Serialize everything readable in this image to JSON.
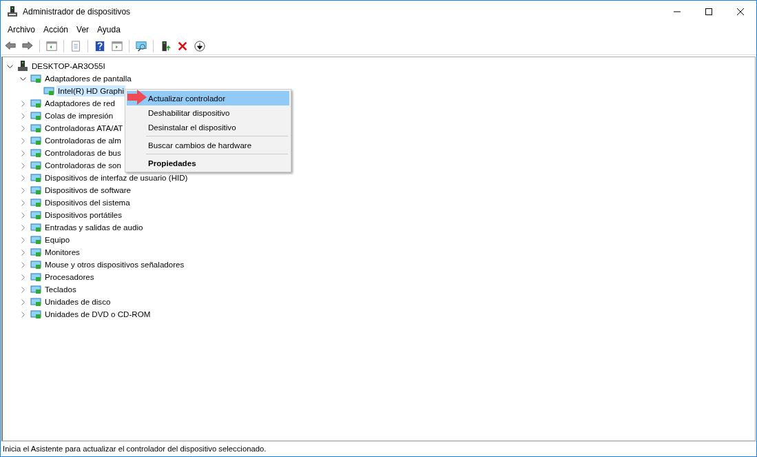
{
  "window": {
    "title": "Administrador de dispositivos"
  },
  "menu_bar": [
    "Archivo",
    "Acción",
    "Ver",
    "Ayuda"
  ],
  "toolbar": [
    {
      "kind": "back"
    },
    {
      "kind": "forward"
    },
    {
      "kind": "sep"
    },
    {
      "kind": "panel"
    },
    {
      "kind": "sep"
    },
    {
      "kind": "sheet"
    },
    {
      "kind": "sep"
    },
    {
      "kind": "help"
    },
    {
      "kind": "panel2"
    },
    {
      "kind": "sep"
    },
    {
      "kind": "scan"
    },
    {
      "kind": "sep"
    },
    {
      "kind": "update"
    },
    {
      "kind": "remove"
    },
    {
      "kind": "down"
    }
  ],
  "tree": {
    "label": "DESKTOP-AR3O55I",
    "expanded": true,
    "selected": false,
    "children": [
      {
        "label": "Adaptadores de pantalla",
        "expanded": true,
        "selected": false,
        "children": [
          {
            "label": "Intel(R) HD Graphi",
            "selected": true
          }
        ]
      },
      {
        "label": "Adaptadores de red",
        "expanded": false,
        "selected": false
      },
      {
        "label": "Colas de impresión",
        "expanded": false,
        "selected": false
      },
      {
        "label": "Controladoras ATA/AT",
        "expanded": false,
        "selected": false
      },
      {
        "label": "Controladoras de alm",
        "expanded": false,
        "selected": false
      },
      {
        "label": "Controladoras de bus",
        "expanded": false,
        "selected": false
      },
      {
        "label": "Controladoras de son",
        "expanded": false,
        "selected": false
      },
      {
        "label": "Dispositivos de interfaz de usuario (HID)",
        "expanded": false,
        "selected": false
      },
      {
        "label": "Dispositivos de software",
        "expanded": false,
        "selected": false
      },
      {
        "label": "Dispositivos del sistema",
        "expanded": false,
        "selected": false
      },
      {
        "label": "Dispositivos portátiles",
        "expanded": false,
        "selected": false
      },
      {
        "label": "Entradas y salidas de audio",
        "expanded": false,
        "selected": false
      },
      {
        "label": "Equipo",
        "expanded": false,
        "selected": false
      },
      {
        "label": "Monitores",
        "expanded": false,
        "selected": false
      },
      {
        "label": "Mouse y otros dispositivos señaladores",
        "expanded": false,
        "selected": false
      },
      {
        "label": "Procesadores",
        "expanded": false,
        "selected": false
      },
      {
        "label": "Teclados",
        "expanded": false,
        "selected": false
      },
      {
        "label": "Unidades de disco",
        "expanded": false,
        "selected": false
      },
      {
        "label": "Unidades de DVD o CD-ROM",
        "expanded": false,
        "selected": false
      }
    ]
  },
  "context_menu": [
    {
      "kind": "item",
      "label": "Actualizar controlador",
      "selected": true,
      "default": false
    },
    {
      "kind": "item",
      "label": "Deshabilitar dispositivo",
      "selected": false,
      "default": false
    },
    {
      "kind": "item",
      "label": "Desinstalar el dispositivo",
      "selected": false,
      "default": false
    },
    {
      "kind": "separator"
    },
    {
      "kind": "item",
      "label": "Buscar cambios de hardware",
      "selected": false,
      "default": false
    },
    {
      "kind": "separator"
    },
    {
      "kind": "item",
      "label": "Propiedades",
      "selected": false,
      "default": true
    }
  ],
  "status_bar": "Inicia el Asistente para actualizar el controlador del dispositivo seleccionado."
}
